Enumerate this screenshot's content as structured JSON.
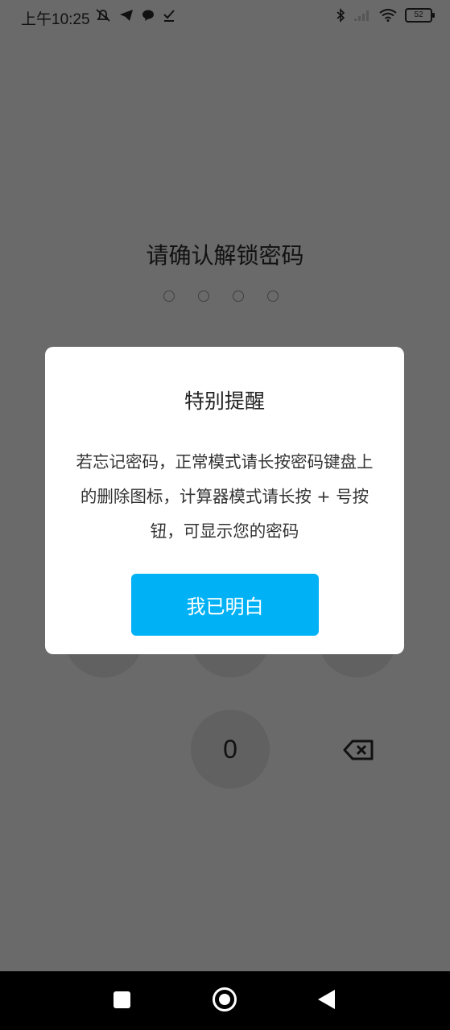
{
  "status": {
    "time": "上午10:25",
    "battery": "52",
    "left_icons": [
      "bell-off-icon",
      "telegram-icon",
      "chat-icon",
      "check-icon"
    ],
    "right_icons": [
      "bluetooth-icon",
      "signal-icon",
      "wifi-icon",
      "battery-icon"
    ]
  },
  "lock": {
    "title": "请确认解锁密码",
    "dots_count": 4
  },
  "keypad": {
    "zero": "0"
  },
  "dialog": {
    "title": "特别提醒",
    "body": "若忘记密码，正常模式请长按密码键盘上的删除图标，计算器模式请长按 + 号按钮，可显示您的密码",
    "confirm": "我已明白"
  },
  "colors": {
    "accent": "#00b2f5",
    "overlay": "#6a6a6a"
  }
}
